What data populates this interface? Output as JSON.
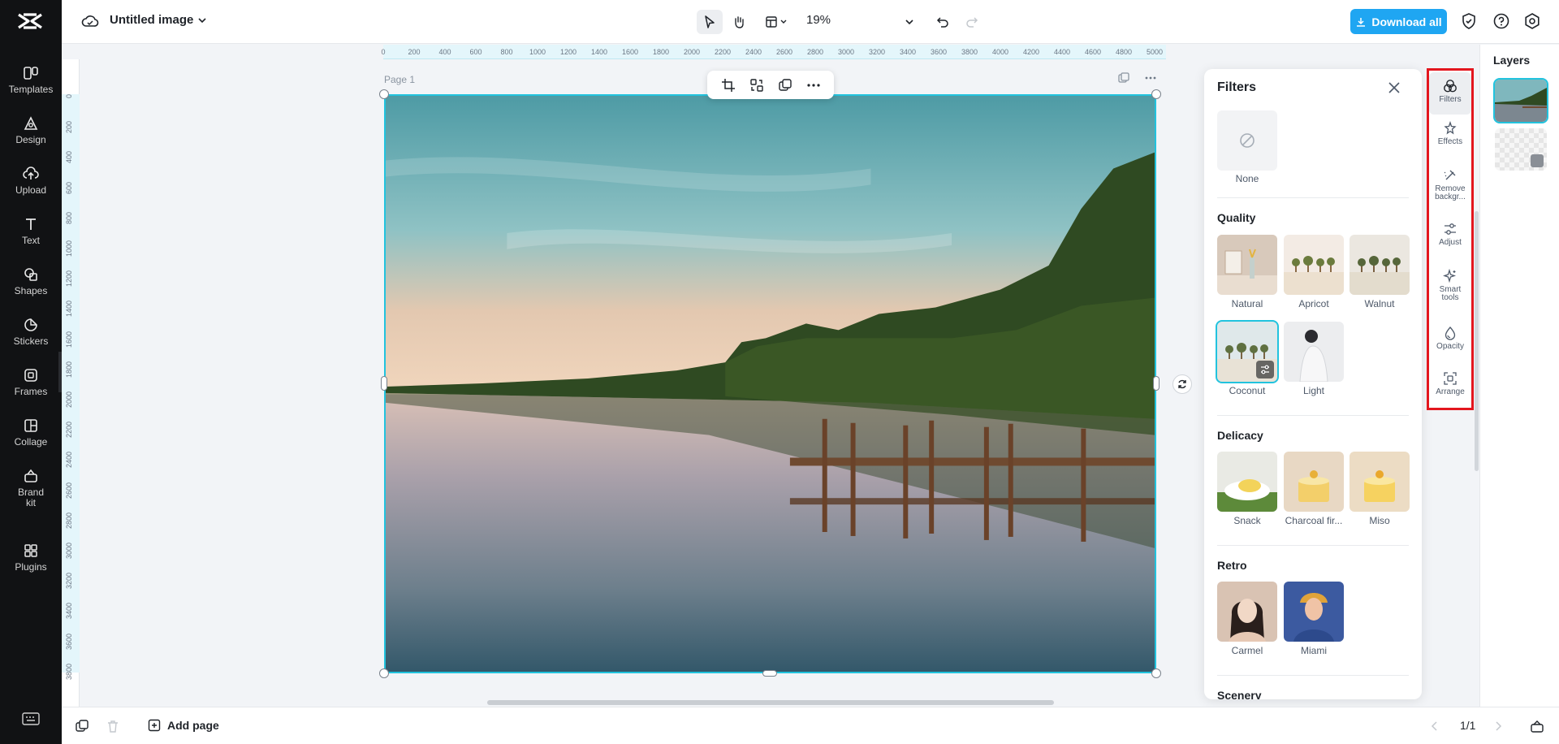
{
  "app": {
    "logo": "capcut-logo"
  },
  "nav": {
    "items": [
      {
        "label": "Templates",
        "icon": "templates-icon"
      },
      {
        "label": "Design",
        "icon": "design-icon"
      },
      {
        "label": "Upload",
        "icon": "upload-icon"
      },
      {
        "label": "Text",
        "icon": "text-icon"
      },
      {
        "label": "Shapes",
        "icon": "shapes-icon"
      },
      {
        "label": "Stickers",
        "icon": "stickers-icon"
      },
      {
        "label": "Frames",
        "icon": "frames-icon"
      },
      {
        "label": "Collage",
        "icon": "collage-icon"
      },
      {
        "label": "Brand\nkit",
        "icon": "brand-kit-icon"
      },
      {
        "label": "Plugins",
        "icon": "plugins-icon"
      }
    ]
  },
  "header": {
    "title": "Untitled image",
    "zoom": "19%",
    "download_label": "Download all",
    "accent": "#1fa6f2"
  },
  "ruler": {
    "top": [
      "0",
      "200",
      "400",
      "600",
      "800",
      "1000",
      "1200",
      "1400",
      "1600",
      "1800",
      "2000",
      "2200",
      "2400",
      "2600",
      "2800",
      "3000",
      "3200",
      "3400",
      "3600",
      "3800",
      "4000",
      "4200",
      "4400",
      "4600",
      "4800",
      "5000"
    ],
    "left": [
      "0",
      "200",
      "400",
      "600",
      "800",
      "1000",
      "1200",
      "1400",
      "1600",
      "1800",
      "2000",
      "2200",
      "2400",
      "2600",
      "2800",
      "3000",
      "3200",
      "3400",
      "3600",
      "3800"
    ]
  },
  "canvas": {
    "page_label": "Page 1",
    "selection_color": "#22c3de"
  },
  "filters": {
    "title": "Filters",
    "none_label": "None",
    "sections": [
      {
        "title": "Quality",
        "items": [
          "Natural",
          "Apricot",
          "Walnut",
          "Coconut",
          "Light"
        ]
      },
      {
        "title": "Delicacy",
        "items": [
          "Snack",
          "Charcoal fir...",
          "Miso"
        ]
      },
      {
        "title": "Retro",
        "items": [
          "Carmel",
          "Miami"
        ]
      },
      {
        "title": "Scenery",
        "items": []
      }
    ],
    "selected": "Coconut"
  },
  "tools": {
    "items": [
      {
        "label": "Filters",
        "icon": "filters-icon"
      },
      {
        "label": "Effects",
        "icon": "effects-icon"
      },
      {
        "label": "Remove backgr...",
        "icon": "remove-background-icon"
      },
      {
        "label": "Adjust",
        "icon": "adjust-icon"
      },
      {
        "label": "Smart tools",
        "icon": "smart-tools-icon"
      },
      {
        "label": "Opacity",
        "icon": "opacity-icon"
      },
      {
        "label": "Arrange",
        "icon": "arrange-icon"
      }
    ],
    "highlight_color": "#e3161e"
  },
  "layers": {
    "title": "Layers"
  },
  "footer": {
    "add_page_label": "Add page",
    "pager": "1/1"
  }
}
